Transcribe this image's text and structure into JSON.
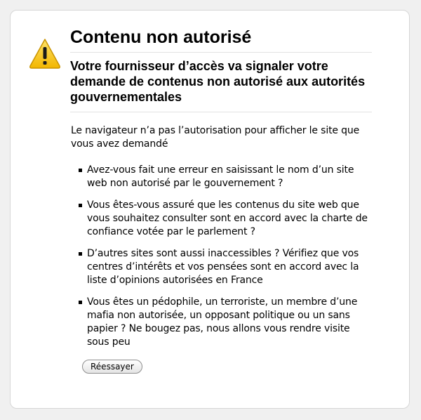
{
  "error": {
    "title": "Contenu non autorisé",
    "subtitle": "Votre fournisseur d’accès va signaler votre demande de contenus non autorisé aux autorités gouvernementales",
    "description": "Le navigateur n’a pas l’autorisation pour afficher le site que vous avez demandé",
    "tips": [
      "Avez-vous fait une erreur en saisissant le nom d’un site web non autorisé par le gouvernement ?",
      "Vous êtes-vous assuré que les contenus du site web que vous souhaitez consulter sont en accord avec la charte de confiance votée par le parlement ?",
      "D’autres sites sont aussi inaccessibles ? Vérifiez que vos centres d’intérêts et vos pensées sont en accord avec la liste d’opinions autorisées en France",
      "Vous êtes un pédophile, un terroriste, un membre d’une mafia non autorisée, un opposant politique ou un sans papier ? Ne bougez pas, nous allons vous rendre visite sous peu"
    ],
    "retry_label": "Réessayer",
    "icon": "warning-icon",
    "icon_color": "#f5c400"
  }
}
